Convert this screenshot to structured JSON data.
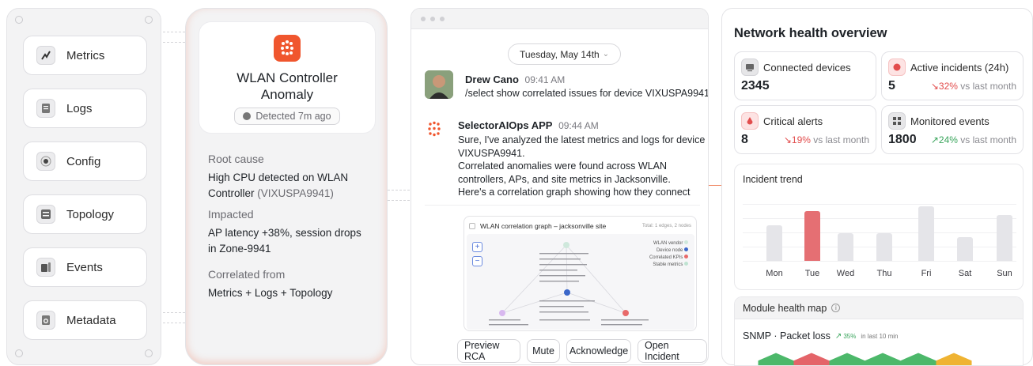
{
  "nav": {
    "items": [
      {
        "label": "Metrics",
        "icon": "metrics-icon"
      },
      {
        "label": "Logs",
        "icon": "logs-icon"
      },
      {
        "label": "Config",
        "icon": "config-icon"
      },
      {
        "label": "Topology",
        "icon": "topology-icon"
      },
      {
        "label": "Events",
        "icon": "events-icon"
      },
      {
        "label": "Metadata",
        "icon": "metadata-icon"
      }
    ]
  },
  "alert": {
    "title_line1": "WLAN Controller",
    "title_line2": "Anomaly",
    "detected": "Detected 7m ago",
    "root_cause_label": "Root cause",
    "root_cause_value": "High CPU detected on WLAN Controller",
    "root_cause_device": "(VIXUSPA9941)",
    "impacted_label": "Impacted",
    "impacted_value": "AP latency +38%, session drops in Zone-9941",
    "correlated_label": "Correlated from",
    "correlated_value": "Metrics + Logs + Topology",
    "accent_color": "#f0562e"
  },
  "chat": {
    "date": "Tuesday, May 14th",
    "messages": [
      {
        "author": "Drew Cano",
        "time": "09:41 AM",
        "text": "/select show correlated issues for device VIXUSPA9941"
      },
      {
        "author": "SelectorAIOps APP",
        "time": "09:44 AM",
        "lines": [
          "Sure, I've analyzed the latest metrics and logs for device",
          "VIXUSPA9941.",
          "Correlated anomalies were found across WLAN",
          "controllers, APs, and site metrics in Jacksonville.",
          "Here's a correlation graph showing how they connect"
        ]
      }
    ],
    "graph": {
      "title": "WLAN correlation graph – jacksonville site",
      "total": "Total: 1 edges, 2 nodes",
      "zoom_in": "+",
      "zoom_out": "−",
      "legend": [
        {
          "label": "WLAN vendor",
          "color": "#cfe8dc"
        },
        {
          "label": "Device node",
          "color": "#3b67c9"
        },
        {
          "label": "Correlated KPIs",
          "color": "#e86a6a"
        },
        {
          "label": "Stable metrics",
          "color": "#bfe3d2"
        }
      ]
    },
    "actions": [
      "Preview RCA",
      "Mute",
      "Acknowledge",
      "Open Incident"
    ]
  },
  "health": {
    "title": "Network health overview",
    "stats": [
      {
        "label": "Connected devices",
        "value": "2345",
        "delta": "",
        "delta_suffix": ""
      },
      {
        "label": "Active incidents (24h)",
        "value": "5",
        "delta": "32%",
        "delta_suffix": "vs last month",
        "trend": "down"
      },
      {
        "label": "Critical alerts",
        "value": "8",
        "delta": "19%",
        "delta_suffix": "vs last month",
        "trend": "down"
      },
      {
        "label": "Monitored events",
        "value": "1800",
        "delta": "24%",
        "delta_suffix": "vs last month",
        "trend": "up"
      }
    ],
    "trend": {
      "title": "Incident trend",
      "days": [
        "Mon",
        "Tue",
        "Wed",
        "Thu",
        "Fri",
        "Sat",
        "Sun"
      ],
      "values": [
        0.62,
        0.88,
        0.49,
        0.49,
        0.96,
        0.42,
        0.8
      ],
      "highlight_index": 1,
      "highlight_color": "#e56f73",
      "bar_color": "#e5e5e9"
    },
    "module_map": {
      "title": "Module health map",
      "metric": "SNMP · Packet loss",
      "delta": "35%",
      "delta_suffix": "in last 10 min",
      "hex_colors": [
        "#4cb86a",
        "#e46469",
        "#4cb86a",
        "#4cb86a",
        "#4cb86a",
        "#efb332"
      ]
    }
  }
}
